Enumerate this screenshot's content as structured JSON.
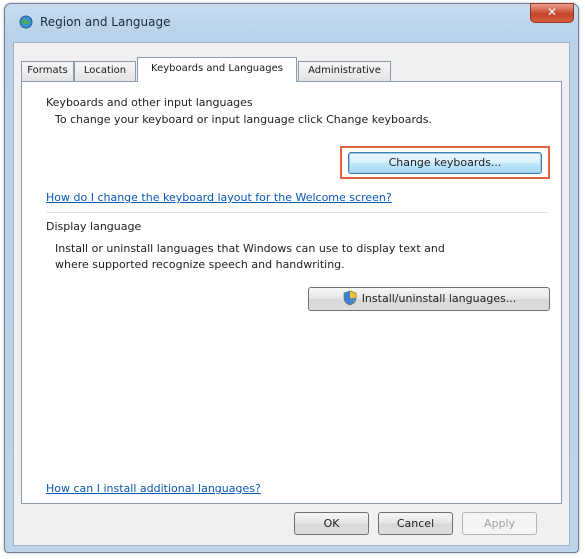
{
  "window": {
    "title": "Region and Language",
    "close_label": "✕"
  },
  "tabs": [
    {
      "label": "Formats"
    },
    {
      "label": "Location"
    },
    {
      "label": "Keyboards and Languages",
      "active": true
    },
    {
      "label": "Administrative"
    }
  ],
  "keyboards_section": {
    "heading": "Keyboards and other input languages",
    "description": "To change your keyboard or input language click Change keyboards.",
    "change_button_label": "Change keyboards...",
    "welcome_link": "How do I change the keyboard layout for the Welcome screen?"
  },
  "display_section": {
    "heading": "Display language",
    "description_line1": "Install or uninstall languages that Windows can use to display text and",
    "description_line2": "where supported recognize speech and handwriting.",
    "install_button_label": "Install/uninstall languages..."
  },
  "footer": {
    "install_link": "How can I install additional languages?"
  },
  "buttons": {
    "ok": "OK",
    "cancel": "Cancel",
    "apply": "Apply"
  },
  "colors": {
    "highlight": "#e0643c",
    "link": "#0a58b4"
  }
}
